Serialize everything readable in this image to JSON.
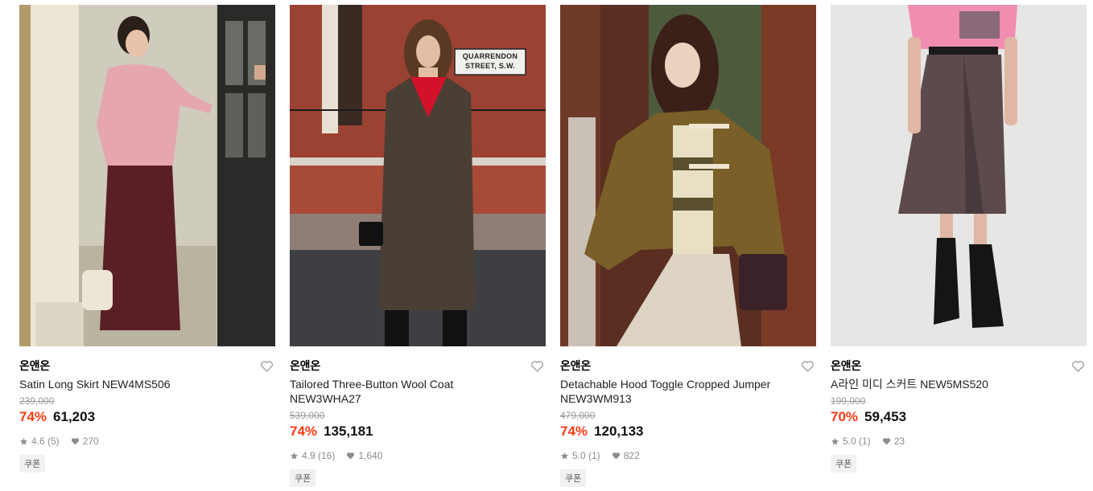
{
  "products": [
    {
      "brand": "온앤온",
      "name": "Satin Long Skirt NEW4MS506",
      "original_price": "239,000",
      "discount": "74%",
      "sale_price": "61,203",
      "rating": "4.6 (5)",
      "likes": "270",
      "coupon": "쿠폰"
    },
    {
      "brand": "온앤온",
      "name": "Tailored Three-Button Wool Coat NEW3WHA27",
      "original_price": "539,000",
      "discount": "74%",
      "sale_price": "135,181",
      "rating": "4.9 (16)",
      "likes": "1,640",
      "coupon": "쿠폰",
      "sign_text": "QUARRENDON STREET, S.W."
    },
    {
      "brand": "온앤온",
      "name": "Detachable Hood Toggle Cropped Jumper NEW3WM913",
      "original_price": "479,000",
      "discount": "74%",
      "sale_price": "120,133",
      "rating": "5.0 (1)",
      "likes": "822",
      "coupon": "쿠폰"
    },
    {
      "brand": "온앤온",
      "name": "A라인 미디 스커트 NEW5MS520",
      "original_price": "199,000",
      "discount": "70%",
      "sale_price": "59,453",
      "rating": "5.0 (1)",
      "likes": "23",
      "coupon": "쿠폰"
    }
  ],
  "colors": {
    "discount": "#ff3a14",
    "strike": "#9a9a9a",
    "meta": "#8c8c8c"
  },
  "icons": {
    "wishlist": "heart-outline-icon",
    "rating": "star-icon",
    "likes": "heart-filled-icon"
  }
}
